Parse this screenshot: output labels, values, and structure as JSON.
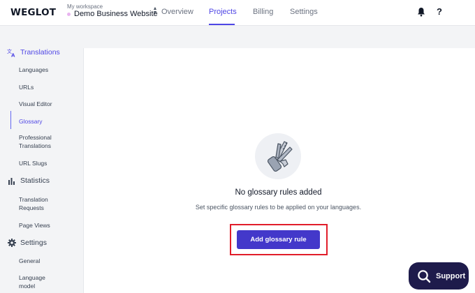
{
  "header": {
    "logo": "WEGLOT",
    "workspace_label": "My workspace",
    "workspace_name": "Demo Business Website",
    "nav": [
      {
        "label": "Overview",
        "active": false
      },
      {
        "label": "Projects",
        "active": true
      },
      {
        "label": "Billing",
        "active": false
      },
      {
        "label": "Settings",
        "active": false
      }
    ],
    "help_label": "?"
  },
  "sidebar": {
    "translations": {
      "label": "Translations",
      "icon": "translate-icon",
      "items": [
        "Languages",
        "URLs",
        "Visual Editor",
        "Glossary",
        "Professional Translations",
        "URL Slugs"
      ]
    },
    "statistics": {
      "label": "Statistics",
      "icon": "bar-chart-icon",
      "items": [
        "Translation Requests",
        "Page Views"
      ]
    },
    "settings": {
      "label": "Settings",
      "icon": "gear-icon",
      "items": [
        "General",
        "Language model"
      ]
    },
    "active_item": "Glossary"
  },
  "main": {
    "illustration_icon": "multitool-icon",
    "empty_title": "No glossary rules added",
    "empty_desc": "Set specific glossary rules to be applied on your languages.",
    "add_button": "Add glossary rule"
  },
  "support": {
    "label": "Support",
    "icon": "search-icon"
  },
  "colors": {
    "accent": "#4f46e5",
    "button": "#4338ca",
    "highlight": "#e11d2a",
    "support_bg": "#1e1b4b"
  }
}
